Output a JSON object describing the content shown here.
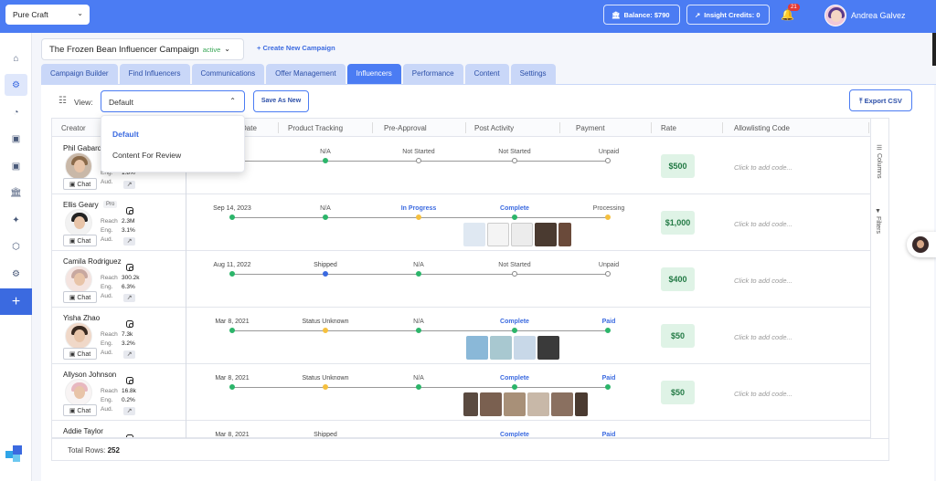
{
  "topbar": {
    "org": "Pure Craft",
    "balance": "Balance: $790",
    "insight_credits": "Insight Credits: 0",
    "notifications": "21",
    "user_name": "Andrea Galvez"
  },
  "campaign": {
    "name": "The Frozen Bean Influencer Campaign",
    "status": "active",
    "new_campaign": "Create New Campaign"
  },
  "tabs": [
    "Campaign Builder",
    "Find Influencers",
    "Communications",
    "Offer Management",
    "Influencers",
    "Performance",
    "Content",
    "Settings"
  ],
  "active_tab": "Influencers",
  "toolbar": {
    "view_label": "View:",
    "view_value": "Default",
    "save_view": "Save As New",
    "export": "Export CSV"
  },
  "view_options": [
    "Default",
    "Content For Review"
  ],
  "columns": [
    "Creator",
    "Date",
    "Product Tracking",
    "Pre-Approval",
    "Post Activity",
    "Payment",
    "Rate",
    "Allowlisting Code"
  ],
  "side_panel": {
    "columns": "Columns",
    "filters": "Filters"
  },
  "stats_labels": {
    "reach": "Reach",
    "eng": "Eng.",
    "aud": "Aud.",
    "chat": "Chat"
  },
  "rows": [
    {
      "name": "Phil Gabard",
      "reach": "",
      "eng": "1.8%",
      "date": "...23",
      "product": "N/A",
      "pre": "Not Started",
      "post": "Not Started",
      "payment": "Unpaid",
      "rate": "$500",
      "allow": "Click to add code..."
    },
    {
      "name": "Ellis Geary",
      "pro": "Pro",
      "reach": "2.3M",
      "eng": "3.1%",
      "date": "Sep 14, 2023",
      "product": "N/A",
      "pre": "In Progress",
      "post": "Complete",
      "payment": "Processing",
      "rate": "$1,000",
      "allow": "Click to add code..."
    },
    {
      "name": "Camila Rodriguez",
      "reach": "300.2k",
      "eng": "6.3%",
      "date": "Aug 11, 2022",
      "product": "Shipped",
      "pre": "N/A",
      "post": "Not Started",
      "payment": "Unpaid",
      "rate": "$400",
      "allow": "Click to add code..."
    },
    {
      "name": "Yisha Zhao",
      "reach": "7.3k",
      "eng": "3.2%",
      "date": "Mar 8, 2021",
      "product": "Status Unknown",
      "pre": "N/A",
      "post": "Complete",
      "payment": "Paid",
      "rate": "$50",
      "allow": "Click to add code..."
    },
    {
      "name": "Allyson Johnson",
      "reach": "16.8k",
      "eng": "0.2%",
      "date": "Mar 8, 2021",
      "product": "Status Unknown",
      "pre": "N/A",
      "post": "Complete",
      "payment": "Paid",
      "rate": "$50",
      "allow": "Click to add code..."
    },
    {
      "name": "Addie Taylor",
      "reach": "",
      "eng": "",
      "date": "Mar 8, 2021",
      "product": "Shipped",
      "pre": "N/A",
      "post": "Complete",
      "payment": "Paid",
      "rate": "",
      "allow": ""
    }
  ],
  "footer": {
    "total_label": "Total Rows:",
    "total_value": "252"
  },
  "colors": {
    "primary": "#4b7cf3",
    "green": "#2cb56a",
    "orange": "#f5c03f",
    "rate_bg": "#dff3e6"
  }
}
